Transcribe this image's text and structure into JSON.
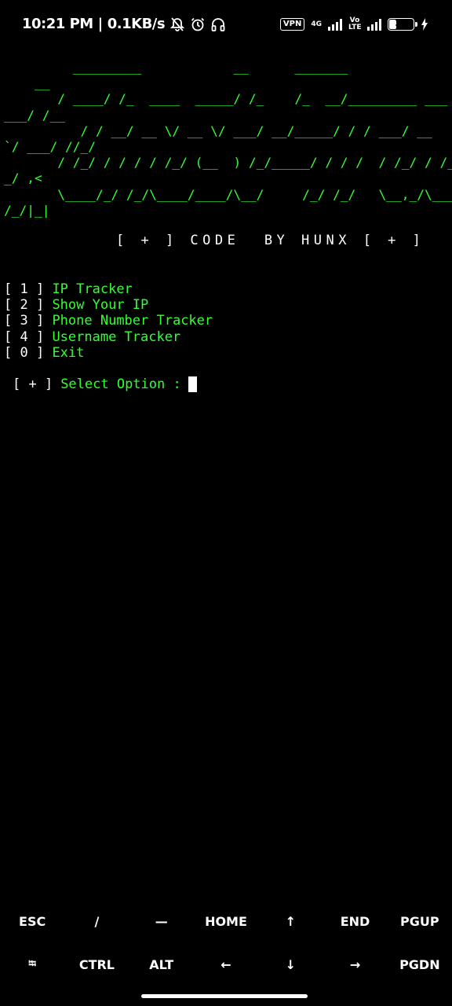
{
  "status_bar": {
    "time": "10:21 PM",
    "speed": "0.1KB/s",
    "vpn": "VPN",
    "network": "4G",
    "volte": "Vo LTE",
    "battery": "32",
    "battery_level": 0.32
  },
  "terminal": {
    "banner": "         _________            __      _______\n    __\n       / ____/ /_  ____  _____/ /_    /_  __/_________ ___\n___/ /__\n          / / __/ __ \\/ __ \\/ ___/ __/_____/ / / ___/ __\n`/ ___/ //_/\n       / /_/ / / / / /_/ (__  ) /_/_____/ / / /  / /_/ / /_\n_/ ,<\n       \\____/_/ /_/\\____/____/\\__/     /_/ /_/   \\__,_/\\___\n/_/|_|",
    "credit": "[ + ] CODE  BY HUNX [ + ]",
    "menu": [
      {
        "num": "[ 1 ]",
        "label": "IP Tracker"
      },
      {
        "num": "[ 2 ]",
        "label": "Show Your IP"
      },
      {
        "num": "[ 3 ]",
        "label": "Phone Number Tracker"
      },
      {
        "num": "[ 4 ]",
        "label": "Username Tracker"
      },
      {
        "num": "[ 0 ]",
        "label": "Exit"
      }
    ],
    "prompt_mark": "[ + ]",
    "prompt_label": "Select Option :"
  },
  "extra_keys": {
    "row1": [
      "ESC",
      "/",
      "—",
      "HOME",
      "↑",
      "END",
      "PGUP"
    ],
    "row2": [
      "⭾",
      "CTRL",
      "ALT",
      "←",
      "↓",
      "→",
      "PGDN"
    ]
  }
}
